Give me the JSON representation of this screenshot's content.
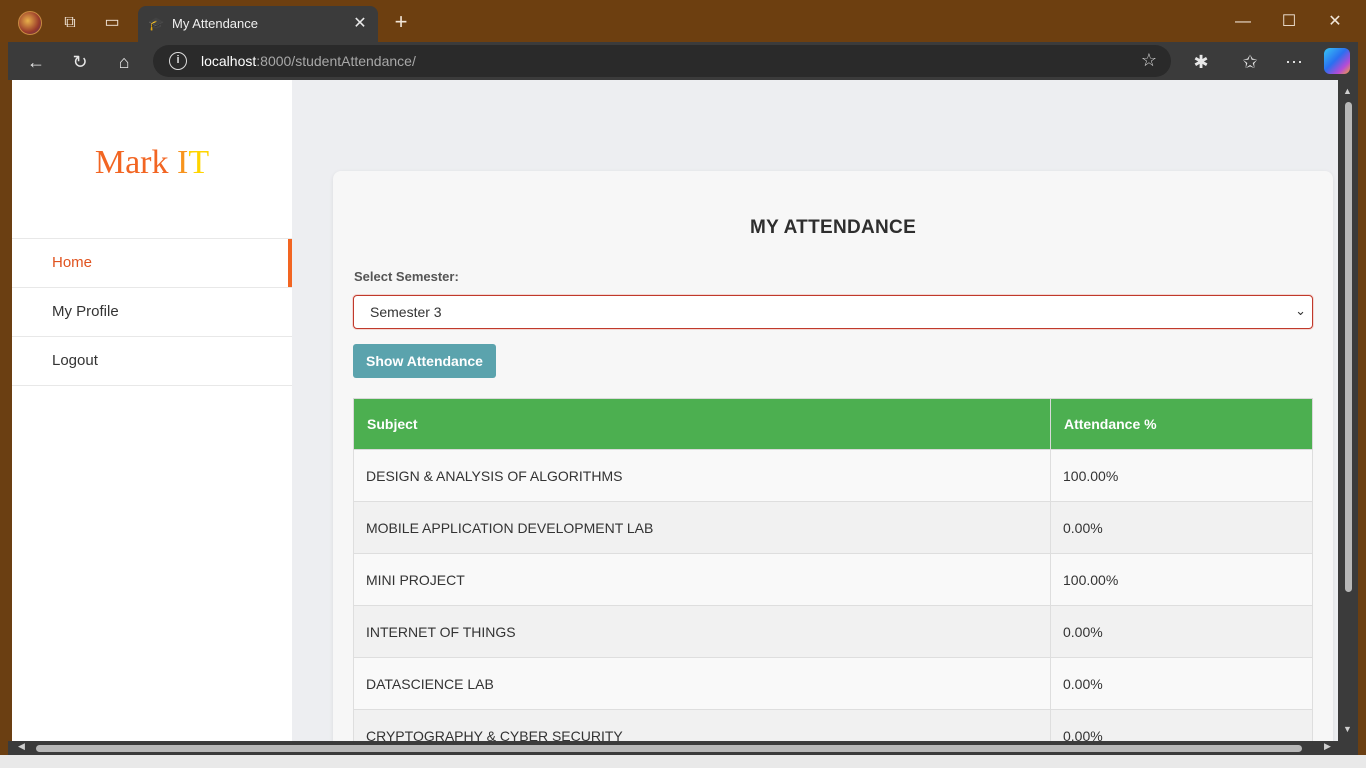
{
  "browser": {
    "tab_title": "My Attendance",
    "tab_close": "✕",
    "new_tab": "+",
    "address_host": "localhost",
    "address_path": ":8000/studentAttendance/",
    "window_controls": {
      "minimize": "—",
      "maximize": "☐",
      "close": "✕"
    }
  },
  "sidebar": {
    "logo": {
      "part1": "Mark ",
      "part2": "I",
      "part3": "T"
    },
    "items": [
      {
        "label": "Home",
        "active": true
      },
      {
        "label": "My Profile",
        "active": false
      },
      {
        "label": "Logout",
        "active": false
      }
    ]
  },
  "main": {
    "title": "MY ATTENDANCE",
    "select_label": "Select Semester:",
    "selected_semester": "Semester 3",
    "show_button": "Show Attendance",
    "table": {
      "headers": [
        "Subject",
        "Attendance %"
      ],
      "rows": [
        {
          "subject": "DESIGN & ANALYSIS OF ALGORITHMS",
          "percent": "100.00%"
        },
        {
          "subject": "MOBILE APPLICATION DEVELOPMENT LAB",
          "percent": "0.00%"
        },
        {
          "subject": "MINI PROJECT",
          "percent": "100.00%"
        },
        {
          "subject": "INTERNET OF THINGS",
          "percent": "0.00%"
        },
        {
          "subject": "DATASCIENCE LAB",
          "percent": "0.00%"
        },
        {
          "subject": "CRYPTOGRAPHY & CYBER SECURITY",
          "percent": "0.00%"
        }
      ]
    }
  },
  "colors": {
    "accent_orange": "#f26522",
    "table_header_green": "#4caf50",
    "button_teal": "#5ba3ad",
    "select_border": "#c0392b"
  }
}
